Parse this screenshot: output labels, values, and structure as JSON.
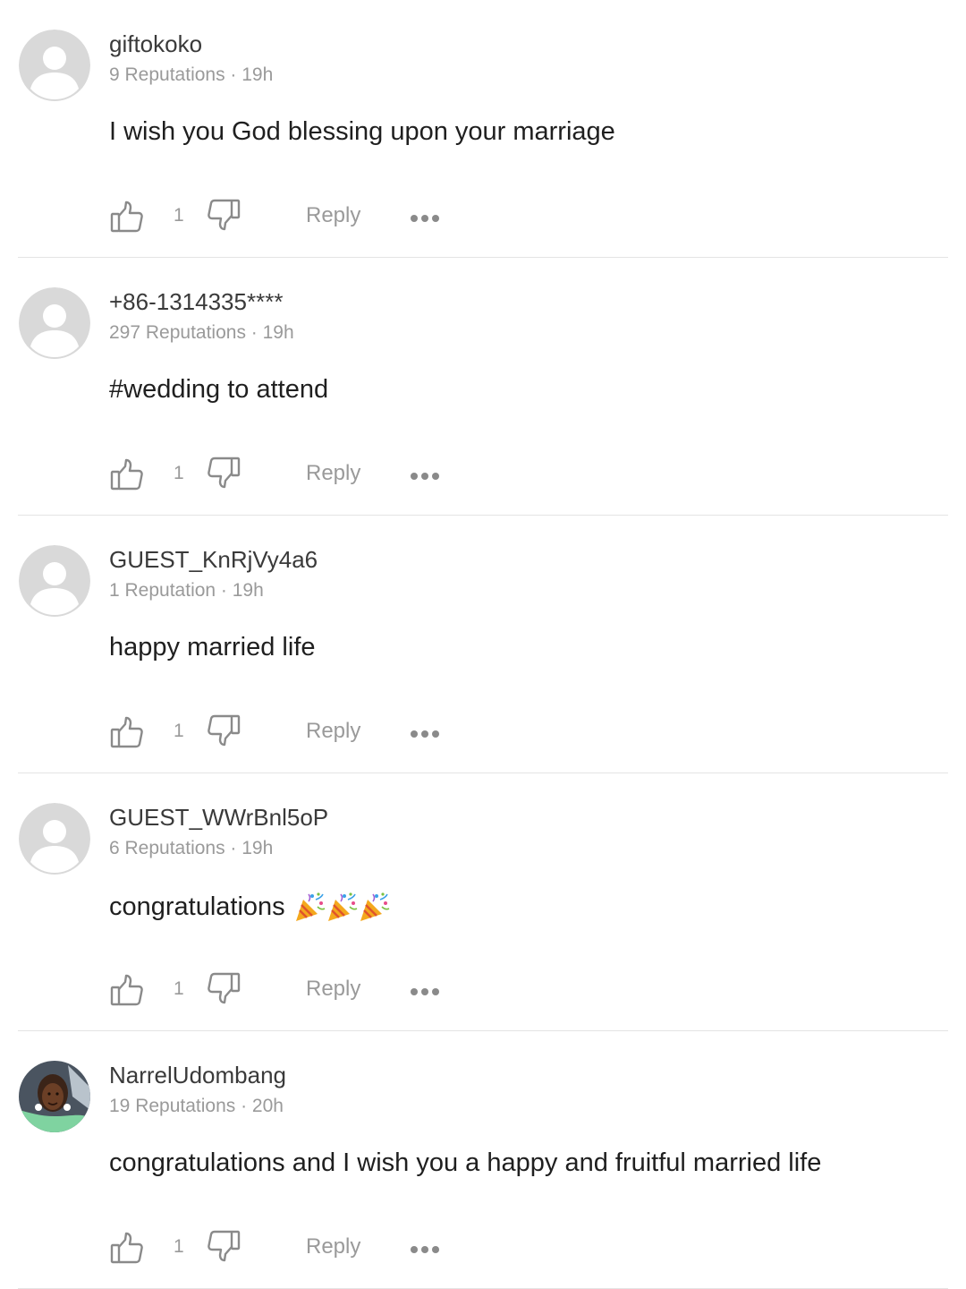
{
  "comments": [
    {
      "username": "giftokoko",
      "meta": "9 Reputations · 19h",
      "text": "I wish you God blessing upon your marriage",
      "emojis": [],
      "like_count": "1",
      "reply_label": "Reply",
      "avatar": "default-avatar"
    },
    {
      "username": "+86-1314335****",
      "meta": "297 Reputations · 19h",
      "text": "#wedding to attend",
      "emojis": [],
      "like_count": "1",
      "reply_label": "Reply",
      "avatar": "default-avatar"
    },
    {
      "username": "GUEST_KnRjVy4a6",
      "meta": "1 Reputation · 19h",
      "text": "happy married life",
      "emojis": [],
      "like_count": "1",
      "reply_label": "Reply",
      "avatar": "default-avatar"
    },
    {
      "username": "GUEST_WWrBnl5oP",
      "meta": "6 Reputations · 19h",
      "text": "congratulations",
      "emojis": [
        "party-popper",
        "party-popper",
        "party-popper"
      ],
      "like_count": "1",
      "reply_label": "Reply",
      "avatar": "default-avatar"
    },
    {
      "username": "NarrelUdombang",
      "meta": "19 Reputations · 20h",
      "text": "congratulations and I wish you a happy and fruitful married life",
      "emojis": [],
      "like_count": "1",
      "reply_label": "Reply",
      "avatar": "photo-avatar"
    }
  ],
  "icons": {
    "like": "thumbs-up-icon",
    "dislike": "thumbs-down-icon",
    "more": "more-options-icon",
    "emoji": "party-popper-icon"
  },
  "colors": {
    "username": "#3a3a3a",
    "meta": "#9a9a9a",
    "text": "#1f1f1f",
    "icon": "#8a8a8a",
    "avatar_bg": "#d9d9d9",
    "divider": "#e4e4e4"
  }
}
